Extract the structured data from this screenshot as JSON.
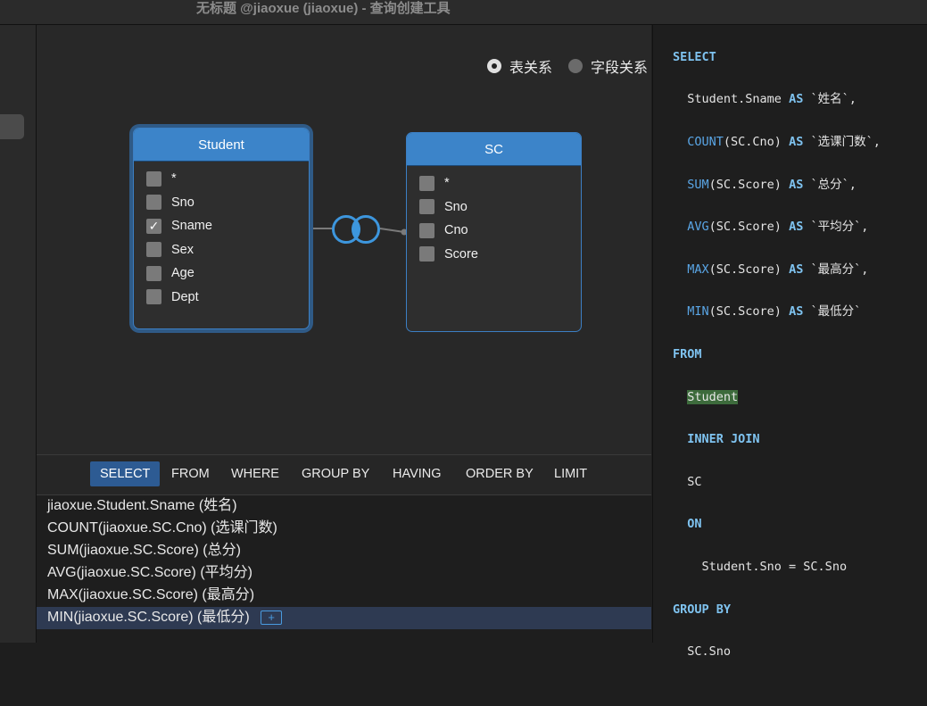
{
  "window": {
    "title": "无标题 @jiaoxue (jiaoxue) - 查询创建工具"
  },
  "diagram": {
    "view_options": [
      {
        "label": "表关系",
        "selected": true
      },
      {
        "label": "字段关系",
        "selected": false
      }
    ],
    "tables": [
      {
        "name": "Student",
        "fields": [
          {
            "name": "*",
            "checked": false
          },
          {
            "name": "Sno",
            "checked": false
          },
          {
            "name": "Sname",
            "checked": true
          },
          {
            "name": "Sex",
            "checked": false
          },
          {
            "name": "Age",
            "checked": false
          },
          {
            "name": "Dept",
            "checked": false
          }
        ]
      },
      {
        "name": "SC",
        "fields": [
          {
            "name": "*",
            "checked": false
          },
          {
            "name": "Sno",
            "checked": false
          },
          {
            "name": "Cno",
            "checked": false
          },
          {
            "name": "Score",
            "checked": false
          }
        ]
      }
    ],
    "join_icon": "inner-join-icon"
  },
  "clauses": [
    "SELECT",
    "FROM",
    "WHERE",
    "GROUP BY",
    "HAVING",
    "ORDER BY",
    "LIMIT"
  ],
  "active_clause": "SELECT",
  "select_expressions": [
    "jiaoxue.Student.Sname  (姓名)",
    "COUNT(jiaoxue.SC.Cno)  (选课门数)",
    "SUM(jiaoxue.SC.Score)  (总分)",
    "AVG(jiaoxue.SC.Score)  (平均分)",
    "MAX(jiaoxue.SC.Score)  (最高分)",
    "MIN(jiaoxue.SC.Score)  (最低分)"
  ],
  "add_button_label": "+",
  "sql": {
    "select_kw": "SELECT",
    "col1": "Student.Sname",
    "as": "AS",
    "alias1": "`姓名`,",
    "fn2": "COUNT",
    "arg2": "(SC.Cno)",
    "alias2": "`选课门数`,",
    "fn3": "SUM",
    "arg3": "(SC.Score)",
    "alias3": "`总分`,",
    "fn4": "AVG",
    "arg4": "(SC.Score)",
    "alias4": "`平均分`,",
    "fn5": "MAX",
    "arg5": "(SC.Score)",
    "alias5": "`最高分`,",
    "fn6": "MIN",
    "arg6": "(SC.Score)",
    "alias6": "`最低分`",
    "from_kw": "FROM",
    "table1": "Student",
    "join_kw": "INNER JOIN",
    "table2": "SC",
    "on_kw": "ON",
    "condition": "Student.Sno = SC.Sno",
    "groupby_kw": "GROUP BY",
    "group_col": "SC.Sno"
  },
  "colors": {
    "table_header": "#3c84c9",
    "active_clause": "#2d5b93",
    "keyword": "#7fc3f0",
    "highlight": "#3d6b3c"
  }
}
